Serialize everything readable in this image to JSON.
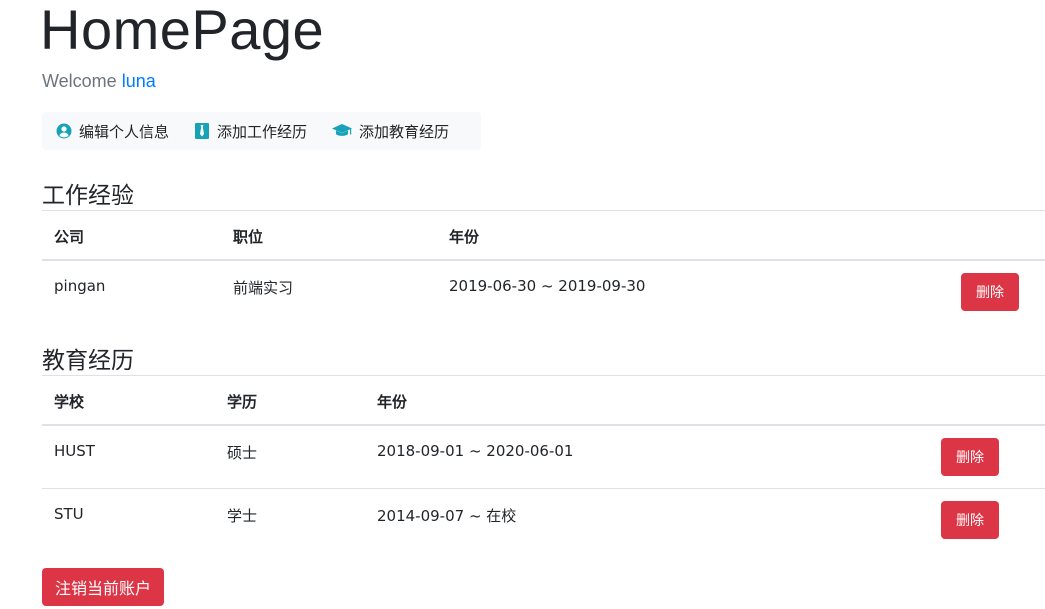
{
  "header": {
    "title": "HomePage",
    "welcome_prefix": "Welcome",
    "username": "luna"
  },
  "actions": [
    {
      "label": "编辑个人信息",
      "icon": "user-circle-icon"
    },
    {
      "label": "添加工作经历",
      "icon": "tie-icon"
    },
    {
      "label": "添加教育经历",
      "icon": "graduation-cap-icon"
    }
  ],
  "work": {
    "title": "工作经验",
    "columns": [
      "公司",
      "职位",
      "年份"
    ],
    "rows": [
      {
        "company": "pingan",
        "position": "前端实习",
        "years": "2019-06-30 ~ 2019-09-30",
        "delete_label": "删除"
      }
    ]
  },
  "education": {
    "title": "教育经历",
    "columns": [
      "学校",
      "学历",
      "年份"
    ],
    "rows": [
      {
        "school": "HUST",
        "degree": "硕士",
        "years": "2018-09-01 ~ 2020-06-01",
        "delete_label": "删除"
      },
      {
        "school": "STU",
        "degree": "学士",
        "years": "2014-09-07 ~ 在校",
        "delete_label": "删除"
      }
    ]
  },
  "footer": {
    "logout_label": "注销当前账户"
  },
  "colors": {
    "danger": "#dc3545",
    "link": "#007bff",
    "icon_teal": "#17a2b8"
  }
}
